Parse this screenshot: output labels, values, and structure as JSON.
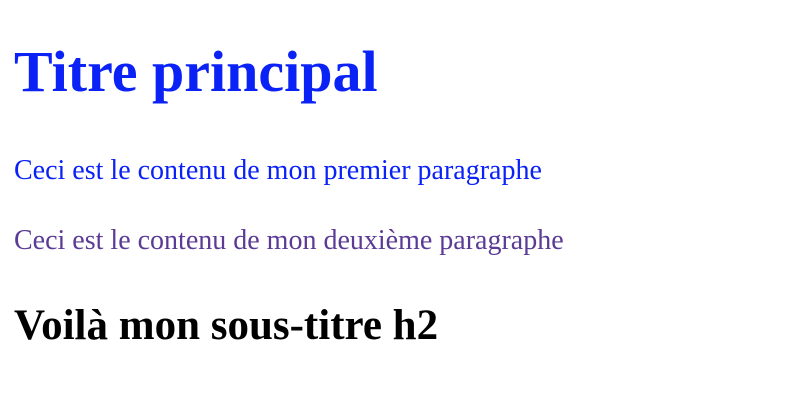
{
  "heading": {
    "title": "Titre principal",
    "color": "#0a22f5"
  },
  "paragraphs": [
    {
      "text": "Ceci est le contenu de mon premier paragraphe",
      "color": "#0a22f5"
    },
    {
      "text": "Ceci est le contenu de mon deuxième paragraphe",
      "color": "#5b3b95"
    }
  ],
  "subheading": {
    "title": "Voilà mon sous-titre h2",
    "color": "#000000"
  }
}
